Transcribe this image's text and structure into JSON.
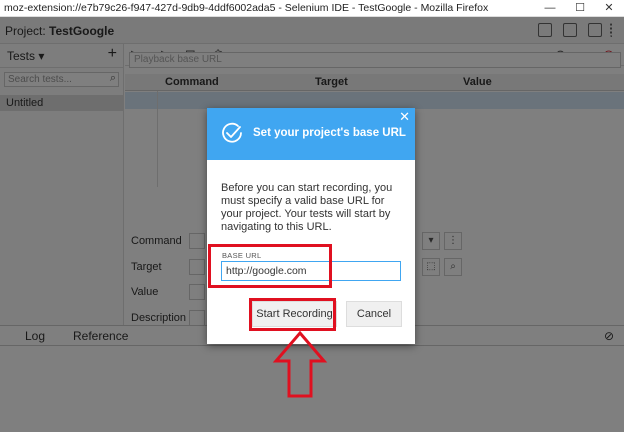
{
  "window": {
    "title": "moz-extension://e7b79c26-f947-427d-9db9-4ddf6002ada5 - Selenium IDE - TestGoogle - Mozilla Firefox",
    "minimize": "—",
    "maximize": "☐",
    "close": "✕"
  },
  "project": {
    "label": "Project:",
    "name": "TestGoogle"
  },
  "sidebar": {
    "header": "Tests ▾",
    "add": "+",
    "search_placeholder": "Search tests...",
    "items": [
      {
        "label": "Untitled"
      }
    ]
  },
  "toolbar": {
    "url_placeholder": "Playback base URL"
  },
  "grid": {
    "columns": [
      "Command",
      "Target",
      "Value"
    ]
  },
  "form": {
    "labels": [
      "Command",
      "Target",
      "Value",
      "Description"
    ]
  },
  "bottom": {
    "tabs": [
      "Log",
      "Reference"
    ]
  },
  "modal": {
    "title": "Set your project's base URL",
    "description": "Before you can start recording, you must specify a valid base URL for your project. Your tests will start by navigating to this URL.",
    "base_url_label": "BASE URL",
    "base_url_value": "http://google.com",
    "start_button": "Start Recording",
    "cancel_button": "Cancel",
    "close": "✕"
  },
  "colors": {
    "accent": "#40a6f1",
    "highlight": "#e01020"
  }
}
